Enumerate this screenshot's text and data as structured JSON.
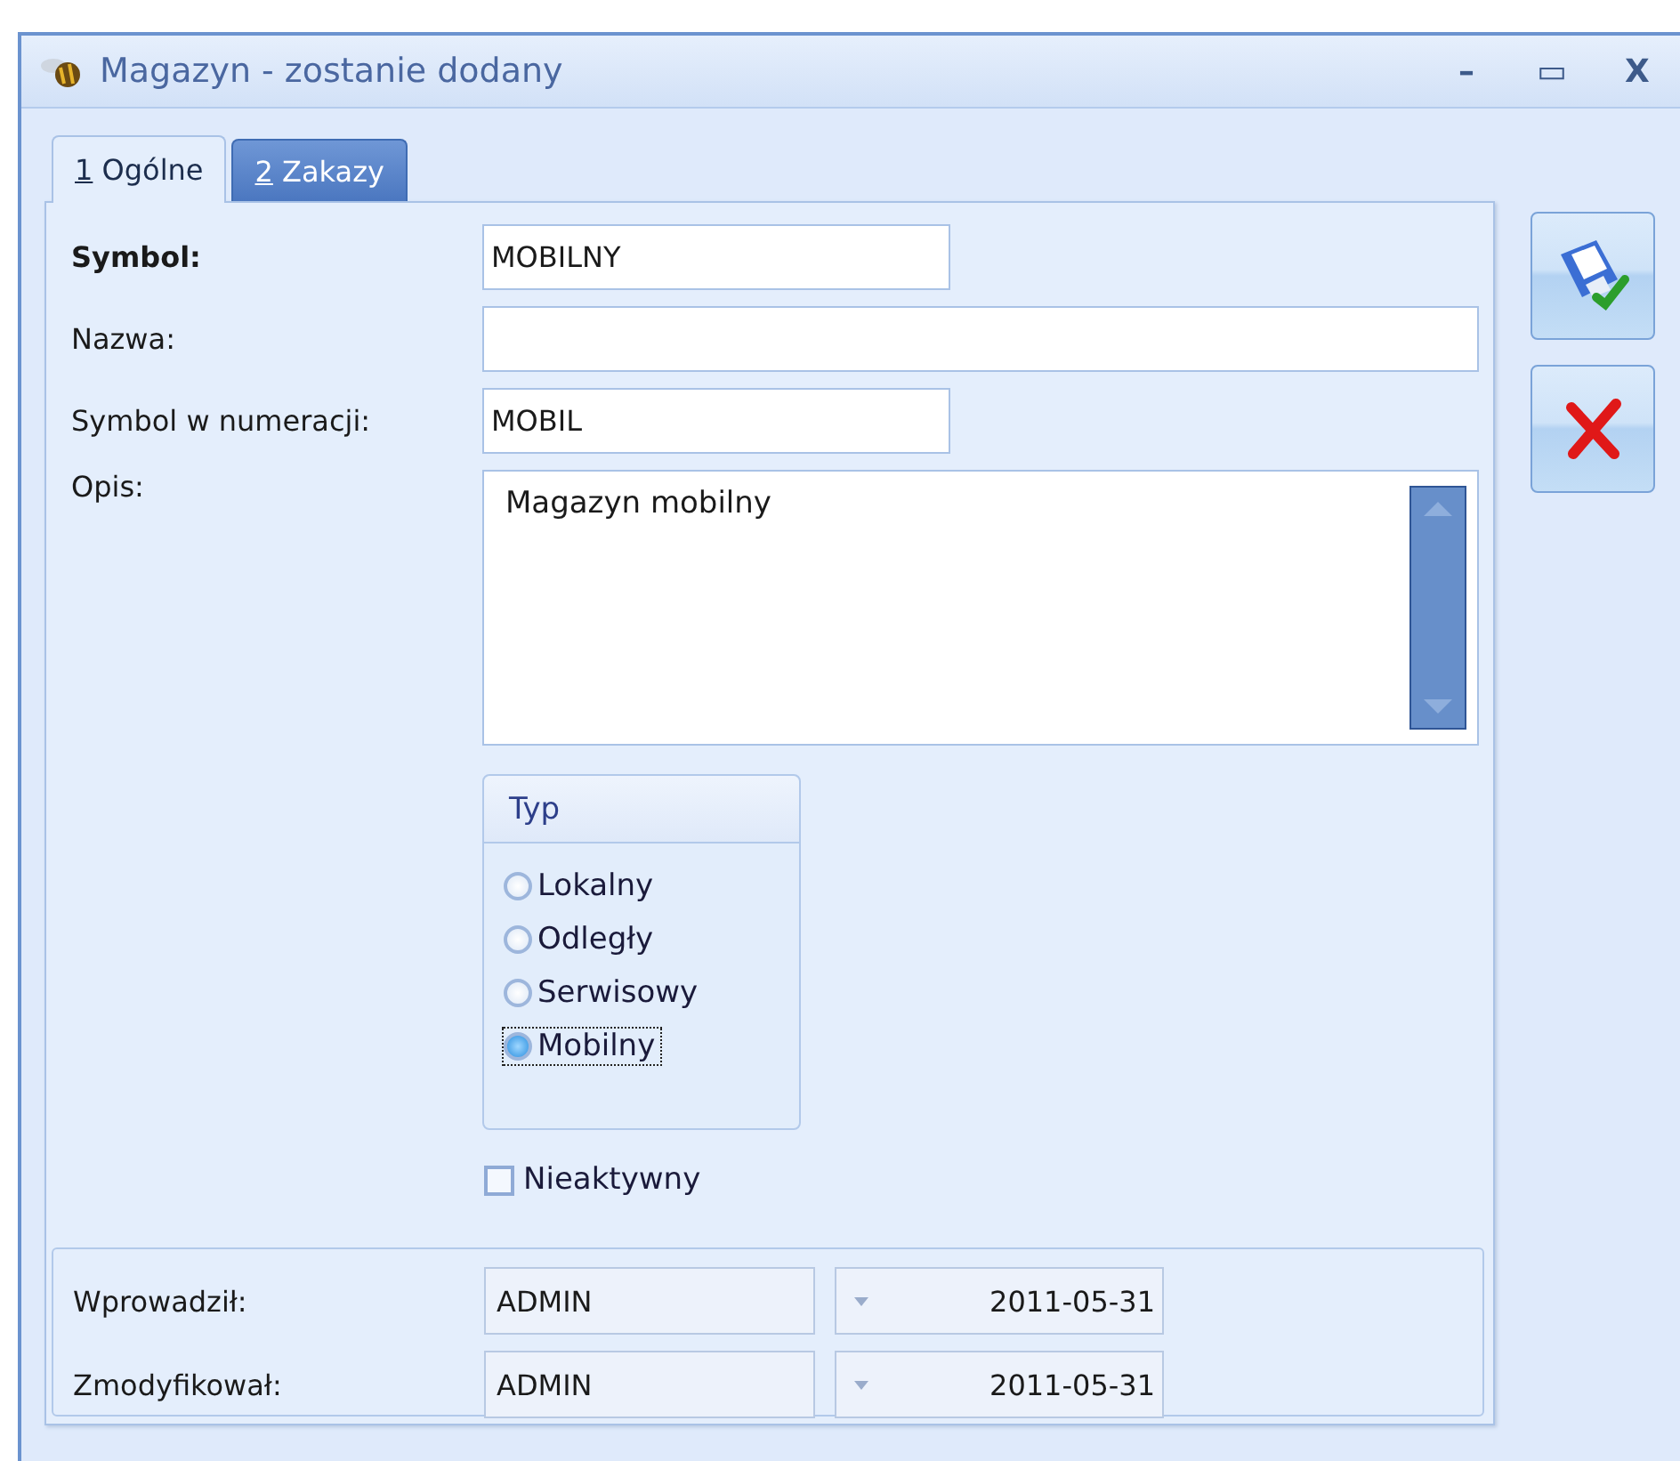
{
  "window": {
    "title": "Magazyn - zostanie dodany",
    "controls": [
      "–",
      "▭",
      "X"
    ]
  },
  "tabs": [
    {
      "key": "1",
      "label": "Ogólne",
      "selected": true
    },
    {
      "key": "2",
      "label": "Zakazy",
      "selected": false
    }
  ],
  "form": {
    "fields": [
      {
        "label": "Symbol:",
        "bold": true,
        "value": "MOBILNY",
        "wide": false
      },
      {
        "label": "Nazwa:",
        "bold": false,
        "wide": true
      },
      {
        "label": "Symbol w numeracji:",
        "bold": false,
        "value": "MOBIL",
        "wide": false
      }
    ],
    "description": {
      "label": "Opis:",
      "value": "Magazyn mobilny"
    },
    "type_group": {
      "title": "Typ",
      "options": [
        {
          "label": "Lokalny",
          "selected": false
        },
        {
          "label": "Odległy",
          "selected": false
        },
        {
          "label": "Serwisowy",
          "selected": false
        },
        {
          "label": "Mobilny",
          "selected": true
        }
      ]
    },
    "inactive": {
      "label": "Nieaktywny",
      "checked": false
    }
  },
  "audit": [
    {
      "label": "Wprowadził:",
      "user": "ADMIN",
      "date": "2011-05-31"
    },
    {
      "label": "Zmodyfikował:",
      "user": "ADMIN",
      "date": "2011-05-31"
    }
  ],
  "actions": [
    {
      "kind": "save"
    },
    {
      "kind": "cancel"
    }
  ]
}
